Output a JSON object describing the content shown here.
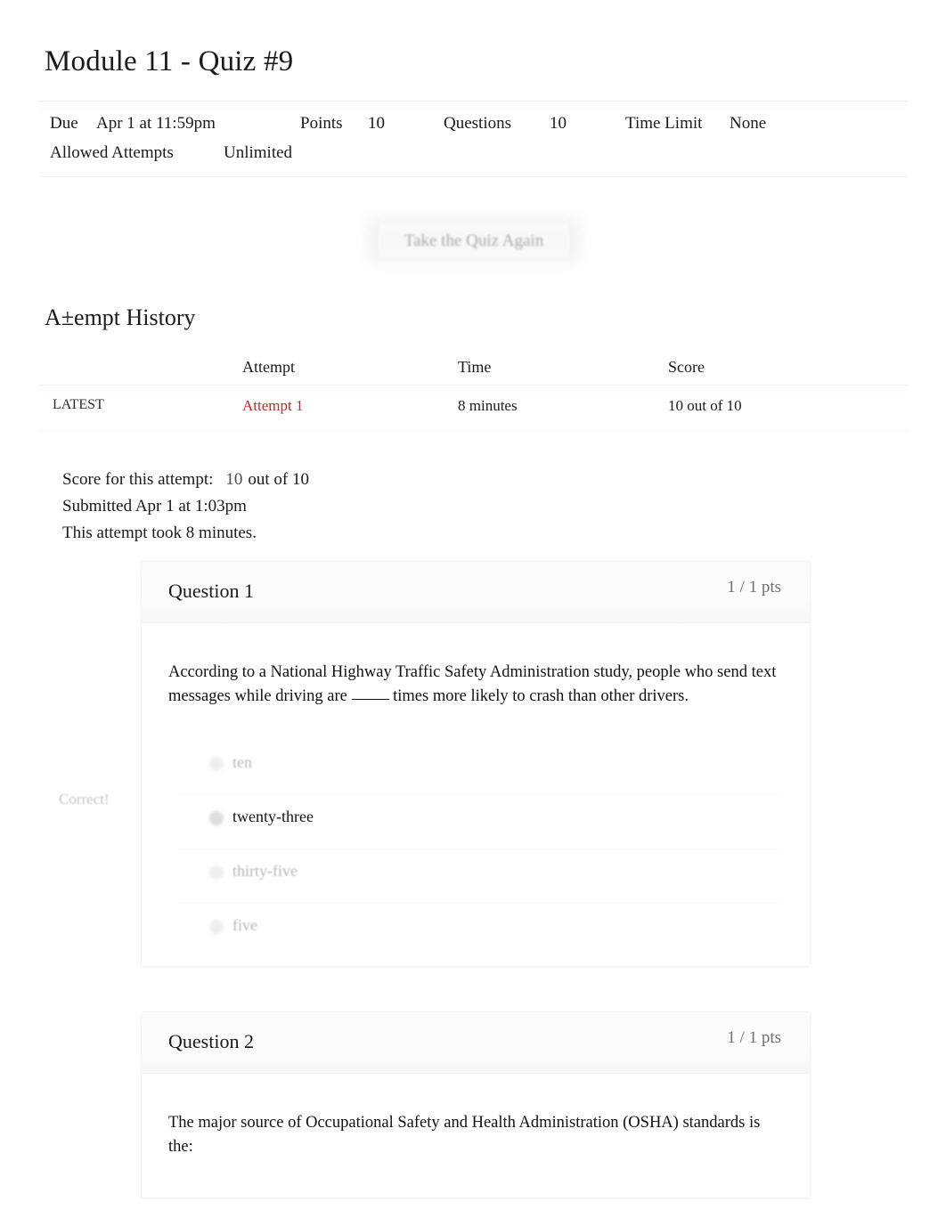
{
  "page": {
    "title": "Module 11 - Quiz #9"
  },
  "meta": {
    "due_label": "Due",
    "due_value": "Apr 1 at 11:59pm",
    "points_label": "Points",
    "points_value": "10",
    "questions_label": "Questions",
    "questions_value": "10",
    "time_limit_label": "Time Limit",
    "time_limit_value": "None",
    "allowed_attempts_label": "Allowed Attempts",
    "allowed_attempts_value": "Unlimited"
  },
  "actions": {
    "take_again_label": "Take the Quiz Again"
  },
  "history": {
    "heading": "A±empt History",
    "columns": {
      "blank": "",
      "attempt": "Attempt",
      "time": "Time",
      "score": "Score"
    },
    "rows": [
      {
        "tag": "LATEST",
        "attempt": "Attempt 1",
        "time": "8 minutes",
        "score": "10 out of 10"
      }
    ]
  },
  "summary": {
    "score_label": "Score for this attempt:",
    "score_value": "10",
    "score_suffix": "out of 10",
    "submitted": "Submitted Apr 1 at 1:03pm",
    "duration": "This attempt took 8 minutes."
  },
  "questions": [
    {
      "title": "Question 1",
      "points": "1 / 1 pts",
      "text_before_blank": "According to a National Highway Traffic Safety Administration study, people who send text messages while driving are ",
      "text_after_blank": " times more likely to crash than other drivers.",
      "correctness_flag": "Correct!",
      "answers": [
        {
          "label": "ten",
          "selected": false
        },
        {
          "label": "twenty-three",
          "selected": true
        },
        {
          "label": "thirty-five",
          "selected": false
        },
        {
          "label": "five",
          "selected": false
        }
      ]
    },
    {
      "title": "Question 2",
      "points": "1 / 1 pts",
      "text": "The major source of Occupational Safety and Health Administration (OSHA) standards is the:"
    }
  ],
  "colors": {
    "link_red": "#b5302b",
    "text": "#1a1a1a",
    "muted": "#6f6f6f"
  }
}
